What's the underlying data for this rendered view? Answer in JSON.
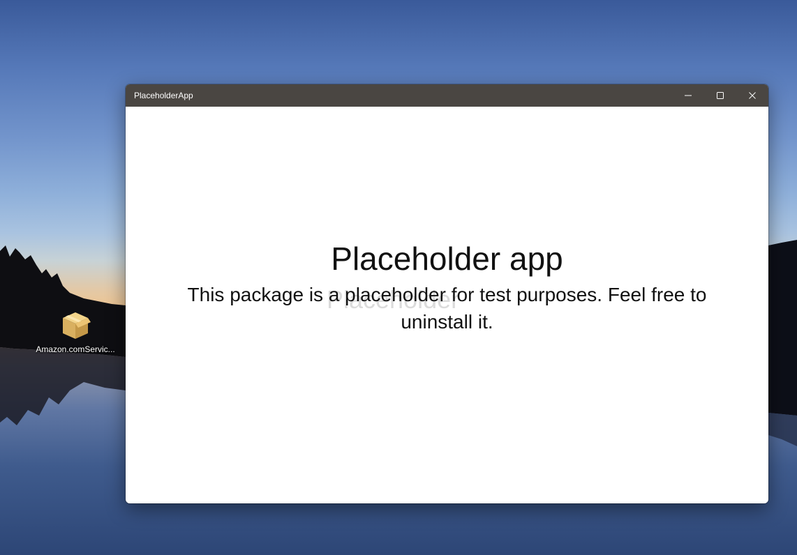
{
  "desktop": {
    "icons": [
      {
        "label": "Amazon.comServic...",
        "icon": "package-box-icon"
      }
    ]
  },
  "window": {
    "title": "PlaceholderApp",
    "controls": {
      "minimize": "minimize-icon",
      "maximize": "maximize-icon",
      "close": "close-icon"
    },
    "heading": "Placeholder app",
    "ghost_heading": "Placeholder",
    "body": "This package is a placeholder for test purposes. Feel free to uninstall it."
  }
}
